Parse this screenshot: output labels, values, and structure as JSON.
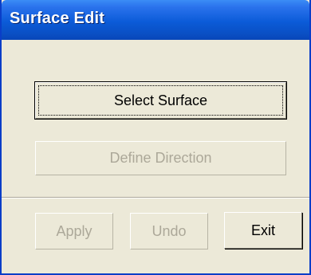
{
  "window": {
    "title": "Surface Edit"
  },
  "buttons": {
    "select_surface": "Select Surface",
    "define_direction": "Define Direction",
    "apply": "Apply",
    "undo": "Undo",
    "exit": "Exit"
  },
  "colors": {
    "titlebar": "#0b5bd8",
    "face": "#ece9d8",
    "disabled_text": "#aca899"
  }
}
